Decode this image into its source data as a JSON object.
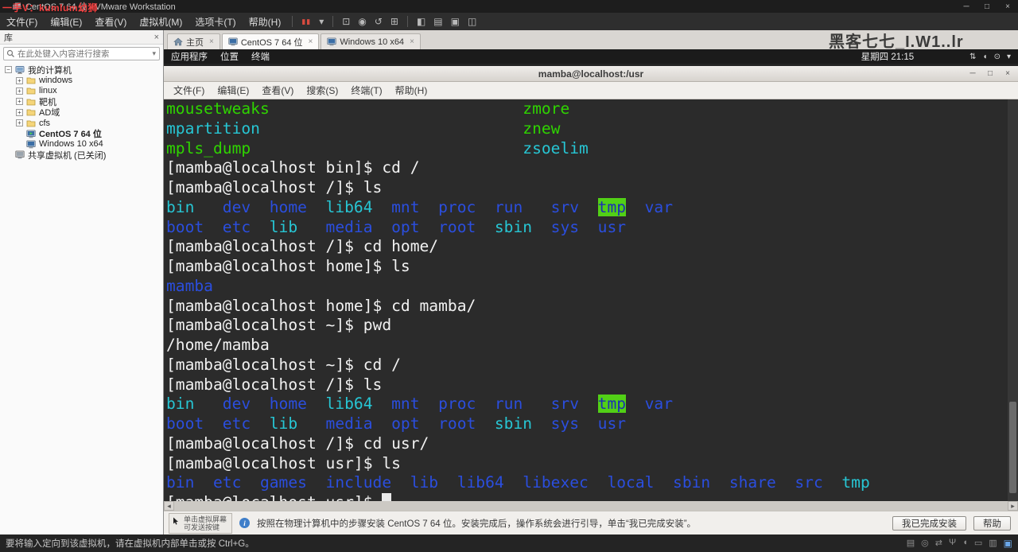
{
  "window": {
    "title": "CentOS 7 64 位 - VMware Workstation",
    "watermark": "一手V：kumlum幼狮",
    "menus": [
      "文件(F)",
      "编辑(E)",
      "查看(V)",
      "虚拟机(M)",
      "选项卡(T)",
      "帮助(H)"
    ],
    "toolbar": [
      {
        "sep": true
      },
      {
        "name": "pause-button",
        "glyph": "▮▮",
        "pause": true
      },
      {
        "name": "pause-dropdown",
        "glyph": "▾"
      },
      {
        "sep": true
      },
      {
        "name": "send-ctrl-alt-del-icon",
        "glyph": "⊡"
      },
      {
        "name": "snapshot-icon",
        "glyph": "◉"
      },
      {
        "name": "revert-snapshot-icon",
        "glyph": "↺"
      },
      {
        "name": "snapshot-manager-icon",
        "glyph": "⊞"
      },
      {
        "sep": true
      },
      {
        "name": "show-library-icon",
        "glyph": "◧"
      },
      {
        "name": "console-view-icon",
        "glyph": "▤"
      },
      {
        "name": "fullscreen-icon",
        "glyph": "▣"
      },
      {
        "name": "unity-icon",
        "glyph": "◫"
      }
    ],
    "controls": [
      {
        "name": "minimize-button",
        "glyph": "─"
      },
      {
        "name": "maximize-button",
        "glyph": "□"
      },
      {
        "name": "close-button",
        "glyph": "×"
      }
    ]
  },
  "sidebar": {
    "header": "库",
    "close_glyph": "×",
    "search_placeholder": "在此处键入内容进行搜索",
    "tree": [
      {
        "label": "我的计算机",
        "type": "computer",
        "exp": "minus",
        "depth": 0
      },
      {
        "label": "windows",
        "type": "folder",
        "exp": "plus",
        "depth": 1
      },
      {
        "label": "linux",
        "type": "folder",
        "exp": "plus",
        "depth": 1
      },
      {
        "label": "靶机",
        "type": "folder",
        "exp": "plus",
        "depth": 1
      },
      {
        "label": "AD域",
        "type": "folder",
        "exp": "plus",
        "depth": 1
      },
      {
        "label": "cfs",
        "type": "folder",
        "exp": "plus",
        "depth": 1
      },
      {
        "label": "CentOS 7 64 位",
        "type": "vm-running",
        "exp": null,
        "depth": 1,
        "active": true
      },
      {
        "label": "Windows 10 x64",
        "type": "vm",
        "exp": null,
        "depth": 1
      },
      {
        "label": "共享虚拟机 (已关闭)",
        "type": "shared",
        "exp": null,
        "depth": 0
      }
    ]
  },
  "tabs": [
    {
      "label": "主页",
      "icon": "home",
      "active": false
    },
    {
      "label": "CentOS 7 64 位",
      "icon": "vm",
      "active": true
    },
    {
      "label": "Windows 10 x64",
      "icon": "vm",
      "active": false
    }
  ],
  "guest": {
    "watermark": "黑客七七_I.W1..lr",
    "topbar": {
      "left": [
        "应用程序",
        "位置",
        "终端"
      ],
      "clock": "星期四 21:15",
      "right_icons": [
        {
          "name": "network-icon",
          "glyph": "⇅"
        },
        {
          "name": "volume-icon",
          "glyph": "◖"
        },
        {
          "name": "power-icon",
          "glyph": "⊙"
        },
        {
          "name": "chevron-down-icon",
          "glyph": "▾"
        }
      ]
    },
    "terminal": {
      "title": "mamba@localhost:/usr",
      "menus": [
        "文件(F)",
        "编辑(E)",
        "查看(V)",
        "搜索(S)",
        "终端(T)",
        "帮助(H)"
      ],
      "controls": [
        {
          "name": "terminal-minimize-button",
          "glyph": "─"
        },
        {
          "name": "terminal-maximize-button",
          "glyph": "□"
        },
        {
          "name": "terminal-close-button",
          "glyph": "×"
        }
      ],
      "lines": [
        [
          {
            "t": "mousetweaks",
            "c": "g"
          },
          {
            "t": "                           "
          },
          {
            "t": "zmore",
            "c": "g"
          }
        ],
        [
          {
            "t": "mpartition",
            "c": "c"
          },
          {
            "t": "                            "
          },
          {
            "t": "znew",
            "c": "g"
          }
        ],
        [
          {
            "t": "mpls_dump",
            "c": "g"
          },
          {
            "t": "                             "
          },
          {
            "t": "zsoelim",
            "c": "c"
          }
        ],
        [
          {
            "t": "[mamba@localhost bin]$ cd /"
          }
        ],
        [
          {
            "t": "[mamba@localhost /]$ ls"
          }
        ],
        [
          {
            "t": "bin",
            "c": "c"
          },
          {
            "t": "   "
          },
          {
            "t": "dev",
            "c": "b"
          },
          {
            "t": "  "
          },
          {
            "t": "home",
            "c": "b"
          },
          {
            "t": "  "
          },
          {
            "t": "lib64",
            "c": "c"
          },
          {
            "t": "  "
          },
          {
            "t": "mnt",
            "c": "b"
          },
          {
            "t": "  "
          },
          {
            "t": "proc",
            "c": "b"
          },
          {
            "t": "  "
          },
          {
            "t": "run",
            "c": "b"
          },
          {
            "t": "   "
          },
          {
            "t": "srv",
            "c": "b"
          },
          {
            "t": "  "
          },
          {
            "t": "tmp",
            "c": "hl"
          },
          {
            "t": "  "
          },
          {
            "t": "var",
            "c": "b"
          }
        ],
        [
          {
            "t": "boot",
            "c": "b"
          },
          {
            "t": "  "
          },
          {
            "t": "etc",
            "c": "b"
          },
          {
            "t": "  "
          },
          {
            "t": "lib",
            "c": "c"
          },
          {
            "t": "   "
          },
          {
            "t": "media",
            "c": "b"
          },
          {
            "t": "  "
          },
          {
            "t": "opt",
            "c": "b"
          },
          {
            "t": "  "
          },
          {
            "t": "root",
            "c": "b"
          },
          {
            "t": "  "
          },
          {
            "t": "sbin",
            "c": "c"
          },
          {
            "t": "  "
          },
          {
            "t": "sys",
            "c": "b"
          },
          {
            "t": "  "
          },
          {
            "t": "usr",
            "c": "b"
          }
        ],
        [
          {
            "t": "[mamba@localhost /]$ cd home/"
          }
        ],
        [
          {
            "t": "[mamba@localhost home]$ ls"
          }
        ],
        [
          {
            "t": "mamba",
            "c": "b"
          }
        ],
        [
          {
            "t": "[mamba@localhost home]$ cd mamba/"
          }
        ],
        [
          {
            "t": "[mamba@localhost ~]$ pwd"
          }
        ],
        [
          {
            "t": "/home/mamba"
          }
        ],
        [
          {
            "t": "[mamba@localhost ~]$ cd /"
          }
        ],
        [
          {
            "t": "[mamba@localhost /]$ ls"
          }
        ],
        [
          {
            "t": "bin",
            "c": "c"
          },
          {
            "t": "   "
          },
          {
            "t": "dev",
            "c": "b"
          },
          {
            "t": "  "
          },
          {
            "t": "home",
            "c": "b"
          },
          {
            "t": "  "
          },
          {
            "t": "lib64",
            "c": "c"
          },
          {
            "t": "  "
          },
          {
            "t": "mnt",
            "c": "b"
          },
          {
            "t": "  "
          },
          {
            "t": "proc",
            "c": "b"
          },
          {
            "t": "  "
          },
          {
            "t": "run",
            "c": "b"
          },
          {
            "t": "   "
          },
          {
            "t": "srv",
            "c": "b"
          },
          {
            "t": "  "
          },
          {
            "t": "tmp",
            "c": "hl"
          },
          {
            "t": "  "
          },
          {
            "t": "var",
            "c": "b"
          }
        ],
        [
          {
            "t": "boot",
            "c": "b"
          },
          {
            "t": "  "
          },
          {
            "t": "etc",
            "c": "b"
          },
          {
            "t": "  "
          },
          {
            "t": "lib",
            "c": "c"
          },
          {
            "t": "   "
          },
          {
            "t": "media",
            "c": "b"
          },
          {
            "t": "  "
          },
          {
            "t": "opt",
            "c": "b"
          },
          {
            "t": "  "
          },
          {
            "t": "root",
            "c": "b"
          },
          {
            "t": "  "
          },
          {
            "t": "sbin",
            "c": "c"
          },
          {
            "t": "  "
          },
          {
            "t": "sys",
            "c": "b"
          },
          {
            "t": "  "
          },
          {
            "t": "usr",
            "c": "b"
          }
        ],
        [
          {
            "t": "[mamba@localhost /]$ cd usr/"
          }
        ],
        [
          {
            "t": "[mamba@localhost usr]$ ls"
          }
        ],
        [
          {
            "t": "bin",
            "c": "b"
          },
          {
            "t": "  "
          },
          {
            "t": "etc",
            "c": "b"
          },
          {
            "t": "  "
          },
          {
            "t": "games",
            "c": "b"
          },
          {
            "t": "  "
          },
          {
            "t": "include",
            "c": "b"
          },
          {
            "t": "  "
          },
          {
            "t": "lib",
            "c": "b"
          },
          {
            "t": "  "
          },
          {
            "t": "lib64",
            "c": "b"
          },
          {
            "t": "  "
          },
          {
            "t": "libexec",
            "c": "b"
          },
          {
            "t": "  "
          },
          {
            "t": "local",
            "c": "b"
          },
          {
            "t": "  "
          },
          {
            "t": "sbin",
            "c": "b"
          },
          {
            "t": "  "
          },
          {
            "t": "share",
            "c": "b"
          },
          {
            "t": "  "
          },
          {
            "t": "src",
            "c": "b"
          },
          {
            "t": "  "
          },
          {
            "t": "tmp",
            "c": "c"
          }
        ],
        [
          {
            "t": "[mamba@localhost usr]$ "
          },
          {
            "t": " ",
            "c": "cur"
          }
        ]
      ]
    }
  },
  "notification": {
    "hint_line1": "单击虚拟屏幕",
    "hint_line2": "可发送按键",
    "message": "按照在物理计算机中的步骤安装 CentOS 7 64 位。安装完成后，操作系统会进行引导，单击“我已完成安装”。",
    "buttons": [
      {
        "name": "finish-install-button",
        "label": "我已完成安装"
      },
      {
        "name": "help-button",
        "label": "帮助"
      }
    ]
  },
  "statusbar": {
    "message": "要将输入定向到该虚拟机，请在虚拟机内部单击或按 Ctrl+G。",
    "icons": [
      {
        "name": "hard-disk-icon",
        "glyph": "▤"
      },
      {
        "name": "cd-rom-icon",
        "glyph": "◎"
      },
      {
        "name": "network-adapter-icon",
        "glyph": "⇄"
      },
      {
        "name": "usb-icon",
        "glyph": "Ψ"
      },
      {
        "name": "sound-icon",
        "glyph": "◖"
      },
      {
        "name": "printer-icon",
        "glyph": "▭"
      },
      {
        "name": "message-log-icon",
        "glyph": "▥"
      },
      {
        "name": "screen-mode-icon",
        "glyph": "▣",
        "accent": true
      }
    ]
  },
  "ui": {
    "close_glyph": "×",
    "caret_down": "▾",
    "scroll_left": "◂",
    "scroll_right": "▸"
  },
  "colors": {
    "terminal_bg": "#2b2b2b",
    "terminal_fg": "#f2f2f2",
    "terminal_green": "#2fd400",
    "terminal_blue": "#2b4ede",
    "terminal_cyan": "#27c6d4",
    "tmp_highlight_bg": "#52d016",
    "tmp_highlight_fg": "#1b2fb4",
    "titlebar_bg": "#1d1d1d",
    "pause_red": "#d74b3f",
    "info_blue": "#3f7ec9"
  }
}
